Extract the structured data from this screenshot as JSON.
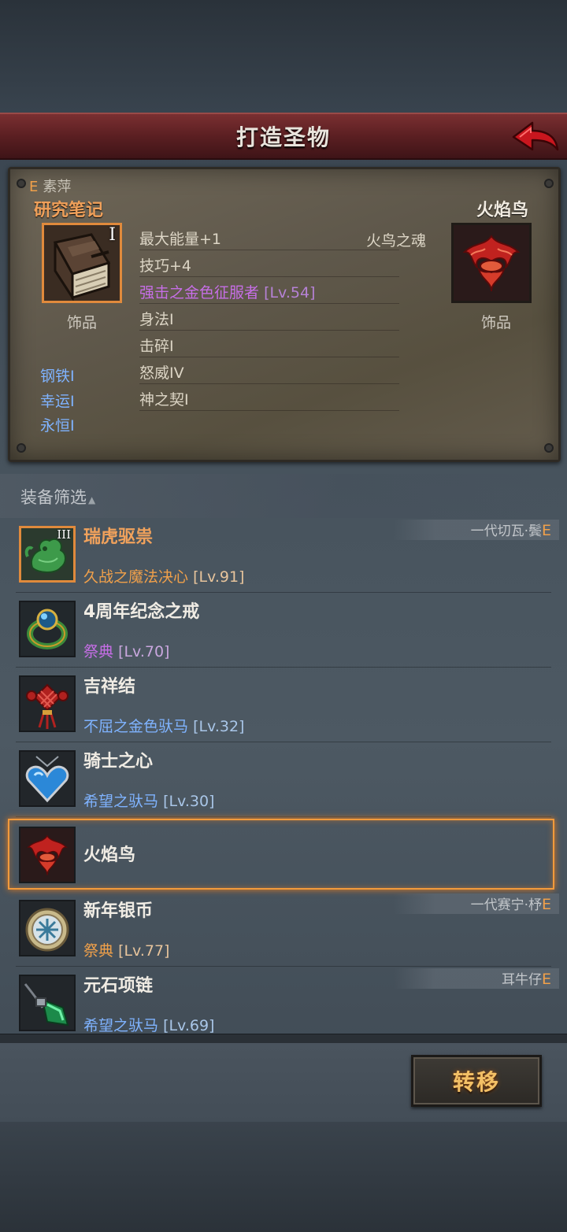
{
  "header": {
    "title": "打造圣物",
    "back_icon": "back-arrow-icon"
  },
  "panel": {
    "grade": "E",
    "owner": "素萍",
    "left_item": {
      "name": "研究笔记",
      "roman": "I",
      "category": "饰品",
      "icon": "notebook-icon",
      "traits": [
        "钢铁I",
        "幸运I",
        "永恒I"
      ]
    },
    "stats": [
      {
        "text": "最大能量+1"
      },
      {
        "text": "技巧+4"
      },
      {
        "text": "强击之金色征服者",
        "lvl": "[Lv.54]"
      },
      {
        "text": "身法I"
      },
      {
        "text": "击碎I"
      },
      {
        "text": "怒威IV"
      },
      {
        "text": "神之契I"
      }
    ],
    "soul": "火鸟之魂",
    "right_item": {
      "name": "火焰鸟",
      "category": "饰品",
      "icon": "firebird-icon"
    }
  },
  "filter": {
    "label": "装备筛选",
    "caret": "▲"
  },
  "list": [
    {
      "name": "瑞虎驱祟",
      "roman": "III",
      "sub": "久战之魔法决心",
      "lvl": "[Lv.91]",
      "tag": "一代切瓦·鬓",
      "grade": "E",
      "icon": "jade-tiger-icon"
    },
    {
      "name": "4周年纪念之戒",
      "sub": "祭典",
      "lvl": "[Lv.70]",
      "icon": "ring-icon"
    },
    {
      "name": "吉祥结",
      "sub": "不屈之金色驮马",
      "lvl": "[Lv.32]",
      "icon": "chinese-knot-icon"
    },
    {
      "name": "骑士之心",
      "sub": "希望之驮马",
      "lvl": "[Lv.30]",
      "icon": "heart-pendant-icon"
    },
    {
      "name": "火焰鸟",
      "icon": "firebird-icon",
      "selected": true
    },
    {
      "name": "新年银币",
      "sub": "祭典",
      "lvl": "[Lv.77]",
      "tag": "一代赛宁·杼",
      "grade": "E",
      "icon": "silver-coin-icon"
    },
    {
      "name": "元石项链",
      "sub": "希望之驮马",
      "lvl": "[Lv.69]",
      "tag": "耳牛仔",
      "grade": "E",
      "icon": "gem-necklace-icon"
    }
  ],
  "footer": {
    "transfer_label": "转移"
  },
  "colors": {
    "accent_orange": "#f0a04a",
    "title_red": "#5b1f22",
    "blue_trait": "#7fb3ff",
    "purple_trait": "#c66ee6"
  }
}
